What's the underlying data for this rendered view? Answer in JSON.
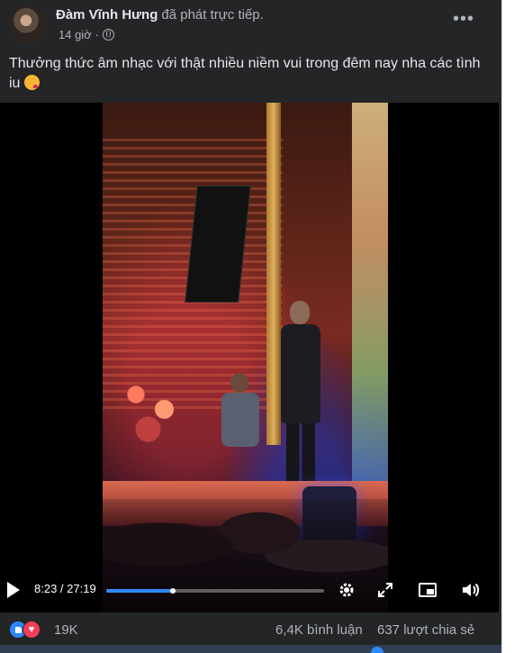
{
  "post": {
    "author_name": "Đàm Vĩnh Hưng",
    "action": "đã phát trực tiếp.",
    "time": "14 giờ ·",
    "text": "Thưởng thức âm nhạc với thật nhiều niềm vui trong đêm nay nha các tình iu",
    "more_label": "•••"
  },
  "video": {
    "time_display": "8:23 / 27:19",
    "progress": 0.307,
    "icons": [
      "play-icon",
      "gear-icon",
      "expand-icon",
      "pip-icon",
      "volume-icon"
    ]
  },
  "stats": {
    "reaction_count": "19K",
    "comments": "6,4K bình luận",
    "shares": "637 lượt chia sẻ"
  },
  "colors": {
    "background": "#242526",
    "text": "#e4e6eb",
    "muted": "#b0b3b8",
    "accent": "#2d88ff",
    "love": "#f33e58"
  }
}
